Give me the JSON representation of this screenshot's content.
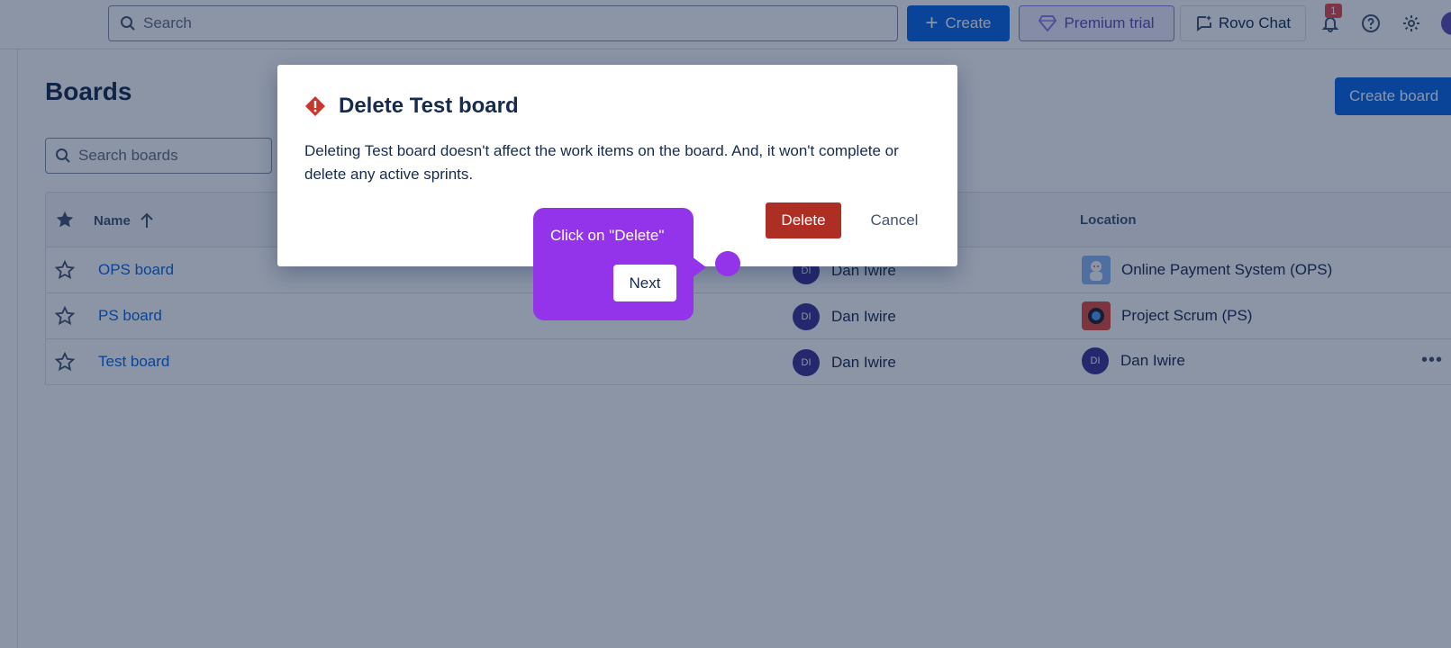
{
  "topbar": {
    "search_placeholder": "Search",
    "create_label": "Create",
    "premium_label": "Premium trial",
    "rovo_label": "Rovo Chat",
    "notification_count": "1"
  },
  "page": {
    "title": "Boards",
    "create_board_label": "Create board",
    "search_placeholder": "Search boards"
  },
  "table": {
    "headers": {
      "name": "Name",
      "location": "Location"
    },
    "rows": [
      {
        "name": "OPS board",
        "admin": "Dan Iwire",
        "admin_initials": "DI",
        "location": "Online Payment System (OPS)"
      },
      {
        "name": "PS board",
        "admin": "Dan Iwire",
        "admin_initials": "DI",
        "location": "Project Scrum (PS)"
      },
      {
        "name": "Test board",
        "admin": "Dan Iwire",
        "admin_initials": "DI",
        "location": "Dan Iwire",
        "location_initials": "DI"
      }
    ]
  },
  "modal": {
    "title": "Delete Test board",
    "body": "Deleting Test board doesn't affect the work items on the board. And, it won't complete or delete any active sprints.",
    "delete_label": "Delete",
    "cancel_label": "Cancel"
  },
  "tooltip": {
    "text": "Click on \"Delete\"",
    "next_label": "Next"
  },
  "colors": {
    "primary": "#0c66e4",
    "danger": "#ae2e24",
    "guide_purple": "#9333ea",
    "overlay": "rgba(9,30,66,0.47)"
  }
}
